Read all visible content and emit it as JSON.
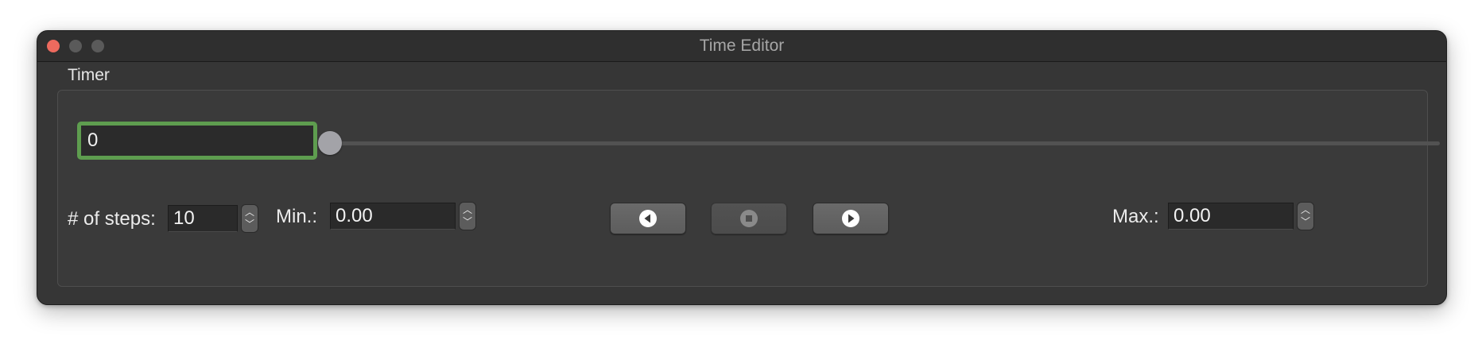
{
  "window": {
    "title": "Time Editor",
    "traffic_colors": {
      "close": "#ed6a5e",
      "minimize": "#5a5a5a",
      "maximize": "#5a5a5a"
    }
  },
  "timer": {
    "group_label": "Timer",
    "time_value": "0",
    "slider_position": 0,
    "steps_label": "# of steps:",
    "steps_value": "10",
    "min_label": "Min.:",
    "min_value": "0.00",
    "max_label": "Max.:",
    "max_value": "0.00",
    "buttons": [
      {
        "icon": "play-backward-icon",
        "enabled": true
      },
      {
        "icon": "stop-icon",
        "enabled": false
      },
      {
        "icon": "play-forward-icon",
        "enabled": true
      }
    ],
    "spin_up_glyph": "︿",
    "spin_down_glyph": "﹀"
  },
  "colors": {
    "focus_ring": "#5e9d4f",
    "window_bg": "#363636",
    "slider_thumb": "#a3a3a8"
  }
}
